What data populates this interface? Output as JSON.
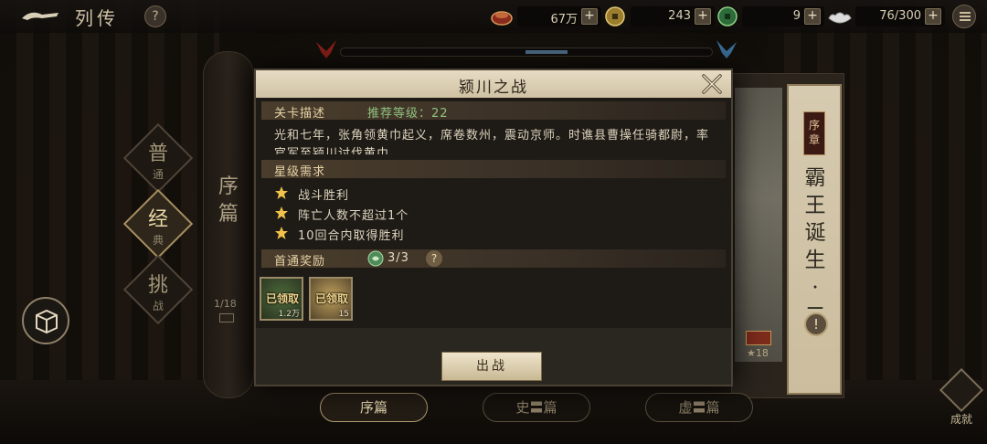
{
  "header": {
    "title": "列传",
    "help": "?",
    "resources": [
      {
        "name": "copper",
        "value": "67万",
        "plus": "+"
      },
      {
        "name": "jade-coin",
        "value": "243",
        "plus": "+"
      },
      {
        "name": "silver",
        "value": "9",
        "plus": "+"
      },
      {
        "name": "stamina",
        "value": "76/300",
        "plus": "+"
      }
    ]
  },
  "left_scroll": {
    "label_chars": [
      "序",
      "篇"
    ],
    "count": "1/18"
  },
  "difficulty": [
    {
      "big": "普",
      "small": "通",
      "active": false
    },
    {
      "big": "经",
      "small": "典",
      "active": true
    },
    {
      "big": "挑",
      "small": "战",
      "active": false
    }
  ],
  "right_panel": {
    "badge": [
      "序",
      "章"
    ],
    "title_chars": [
      "霸",
      "王",
      "诞",
      "生",
      "·",
      "二"
    ],
    "exclaim": "!",
    "chest_stars": "★18"
  },
  "bottom_tabs": [
    {
      "label": "序篇",
      "active": true
    },
    {
      "label": "史〓篇",
      "active": false
    },
    {
      "label": "虚〓篇",
      "active": false
    }
  ],
  "achievement": {
    "label": "成就"
  },
  "modal": {
    "title": "颍川之战",
    "stage_desc_label": "关卡描述",
    "recommend_level": "推荐等级：22",
    "description": "光和七年，张角领黄巾起义，席卷数州，震动京师。时谯县曹操任骑都尉，率官军至颍川讨伐黄巾。",
    "star_req_label": "星级需求",
    "stars": [
      "战斗胜利",
      "阵亡人数不超过1个",
      "10回合内取得胜利"
    ],
    "first_clear_label": "首通奖励",
    "first_clear_count": "3/3",
    "reward_help": "?",
    "rewards": [
      {
        "claimed": "已领取",
        "qty": "1.2万",
        "style": "green"
      },
      {
        "claimed": "已领取",
        "qty": "15",
        "style": "gold"
      }
    ],
    "fight_button": "出战"
  },
  "colors": {
    "accent_gold": "#e6d3a6",
    "recommend_green": "#8fc27f",
    "panel_bg": "#1e1b17"
  }
}
